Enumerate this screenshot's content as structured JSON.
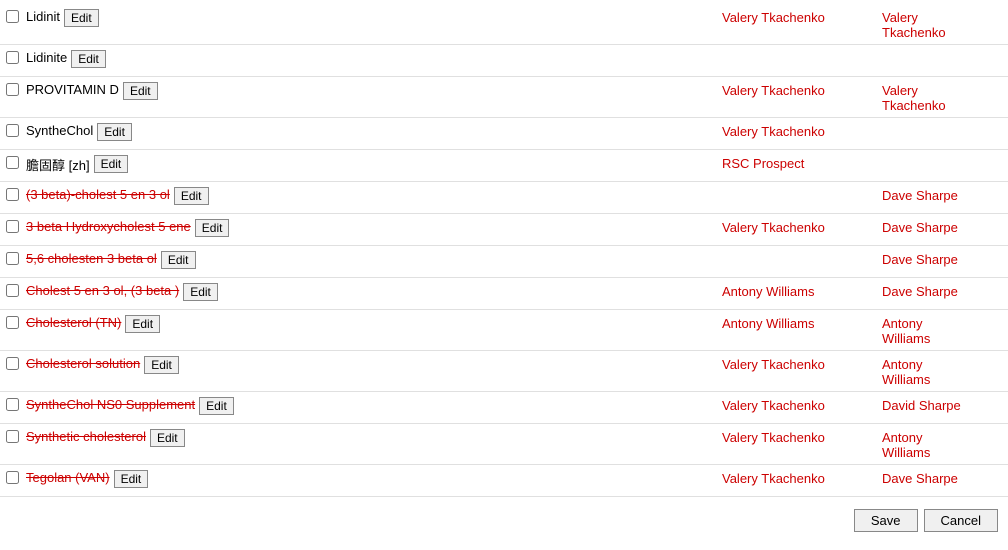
{
  "rows": [
    {
      "id": "row-lidinit",
      "checked": false,
      "nameText": "Lidinit",
      "nameStyle": "normal",
      "col1": "Valery Tkachenko",
      "col2": "Valery\nTkachenko"
    },
    {
      "id": "row-lidinite",
      "checked": false,
      "nameText": "Lidinite",
      "nameStyle": "normal",
      "col1": "",
      "col2": ""
    },
    {
      "id": "row-provitamin",
      "checked": false,
      "nameText": "PROVITAMIN D",
      "nameStyle": "normal",
      "col1": "Valery Tkachenko",
      "col2": "Valery\nTkachenko"
    },
    {
      "id": "row-synthechol",
      "checked": false,
      "nameText": "SyntheChol",
      "nameStyle": "normal",
      "col1": "Valery Tkachenko",
      "col2": ""
    },
    {
      "id": "row-chinese",
      "checked": false,
      "nameText": "膽固醇 [zh]",
      "nameStyle": "normal",
      "col1": "RSC Prospect",
      "col2": ""
    },
    {
      "id": "row-3beta-cholest",
      "checked": false,
      "nameText": "(3 beta)-cholest 5 en 3 ol",
      "nameStyle": "strikethrough",
      "col1": "",
      "col2": "Dave Sharpe"
    },
    {
      "id": "row-3beta-hydroxy",
      "checked": false,
      "nameText": "3 beta Hydroxycholest 5 ene",
      "nameStyle": "strikethrough",
      "col1": "Valery Tkachenko",
      "col2": "Dave Sharpe"
    },
    {
      "id": "row-56-cholesten",
      "checked": false,
      "nameText": "5,6 cholesten 3 beta ol",
      "nameStyle": "strikethrough",
      "col1": "",
      "col2": "Dave Sharpe"
    },
    {
      "id": "row-cholest-5en",
      "checked": false,
      "nameText": "Cholest 5 en 3 ol, (3 beta )",
      "nameStyle": "strikethrough",
      "col1": "Antony Williams",
      "col2": "Dave Sharpe"
    },
    {
      "id": "row-cholesterol-tn",
      "checked": false,
      "nameText": "Cholesterol (TN)",
      "nameStyle": "strikethrough",
      "col1": "Antony Williams",
      "col2": "Antony\nWilliams"
    },
    {
      "id": "row-cholesterol-solution",
      "checked": false,
      "nameText": "Cholesterol solution",
      "nameStyle": "strikethrough",
      "col1": "Valery Tkachenko",
      "col2": "Antony\nWilliams"
    },
    {
      "id": "row-synthechol-ns0",
      "checked": false,
      "nameText": "SyntheChol NS0 Supplement",
      "nameStyle": "strikethrough",
      "col1": "Valery Tkachenko",
      "col2": "David Sharpe"
    },
    {
      "id": "row-synthetic-cholesterol",
      "checked": false,
      "nameText": "Synthetic cholesterol",
      "nameStyle": "strikethrough",
      "col1": "Valery Tkachenko",
      "col2": "Antony\nWilliams"
    },
    {
      "id": "row-tegolan",
      "checked": false,
      "nameText": "Tegolan (VAN)",
      "nameStyle": "strikethrough",
      "col1": "Valery Tkachenko",
      "col2": "Dave Sharpe"
    }
  ],
  "footer": {
    "save_label": "Save",
    "cancel_label": "Cancel"
  }
}
